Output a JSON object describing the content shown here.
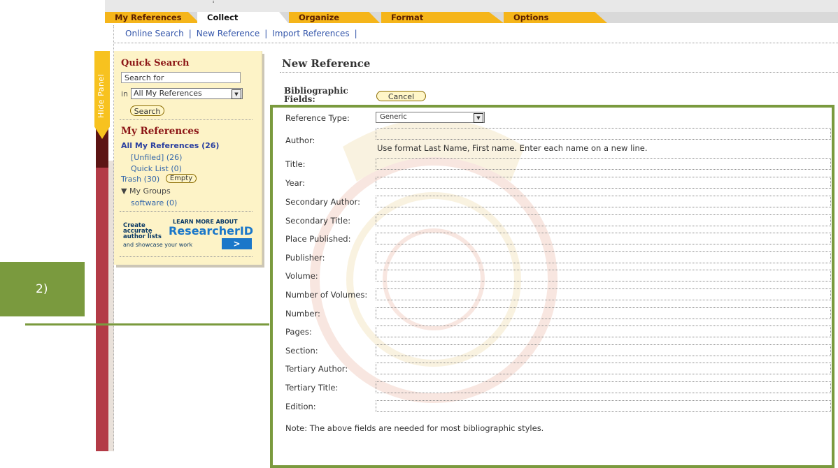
{
  "top_tabs": [
    "My References",
    "Collect",
    "Organize",
    "Format",
    "Options"
  ],
  "caret": "ᶦ",
  "subnav": [
    "Online Search",
    "New Reference",
    "Import References"
  ],
  "hide_panel": "Hide Panel",
  "quick_search": {
    "title": "Quick Search",
    "search_value": "Search for",
    "in_label": "in",
    "scope_selected": "All My References",
    "search_button": "Search"
  },
  "my_references": {
    "title": "My References",
    "all": "All My References (26)",
    "unfiled": "[Unfiled] (26)",
    "quick_list": "Quick List (0)",
    "trash": "Trash (30)",
    "empty_button": "Empty",
    "my_groups": "▼ My Groups",
    "software": "software (0)"
  },
  "ad": {
    "create": "Create\naccurate\nauthor lists",
    "showcase": "and showcase your work",
    "learn": "LEARN MORE ABOUT",
    "brand": "ResearcherID",
    "go": ">"
  },
  "annotation": {
    "label": "2)"
  },
  "main": {
    "title": "New Reference",
    "bib_label_1": "Bibliographic",
    "bib_label_2": "Fields:",
    "cancel": "Cancel",
    "reference_type_label": "Reference Type:",
    "reference_type_value": "Generic",
    "author_hint": "Use format Last Name, First name. Enter each name on a new line.",
    "fields": [
      "Author:",
      "Title:",
      "Year:",
      "Secondary Author:",
      "Secondary Title:",
      "Place Published:",
      "Publisher:",
      "Volume:",
      "Number of Volumes:",
      "Number:",
      "Pages:",
      "Section:",
      "Tertiary Author:",
      "Tertiary Title:",
      "Edition:"
    ],
    "note": "Note: The above fields are needed for most bibliographic styles."
  },
  "colors": {
    "tab_orange": "#f5b51a",
    "panel_yellow": "#fdf3c7",
    "green_highlight": "#7a9a3e",
    "title_red": "#8b1515"
  }
}
